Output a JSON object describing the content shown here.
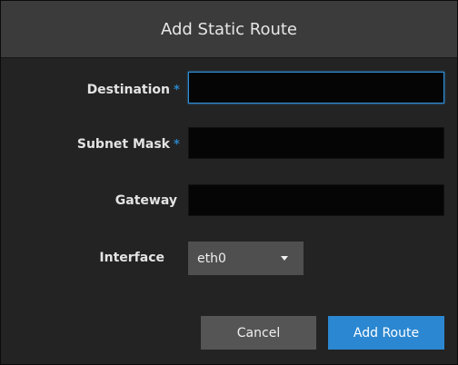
{
  "dialog": {
    "title": "Add Static Route"
  },
  "form": {
    "destination": {
      "label": "Destination",
      "required_mark": "*",
      "value": ""
    },
    "subnet_mask": {
      "label": "Subnet Mask",
      "required_mark": "*",
      "value": ""
    },
    "gateway": {
      "label": "Gateway",
      "value": ""
    },
    "interface": {
      "label": "Interface",
      "selected": "eth0"
    }
  },
  "actions": {
    "cancel_label": "Cancel",
    "submit_label": "Add Route"
  },
  "colors": {
    "accent": "#2b87d1",
    "background": "#232323",
    "header": "#3b3b3b"
  },
  "icons": {
    "dropdown": "chevron-down-icon"
  }
}
